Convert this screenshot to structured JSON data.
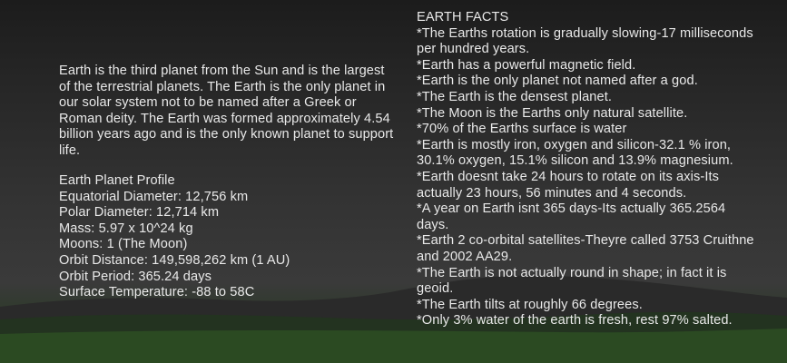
{
  "colors": {
    "text": "#e9e9e9",
    "sky_top": "#1c1c1c",
    "ground": "#243a20"
  },
  "intro": {
    "text": "Earth is the third planet from the Sun and is the largest of the terrestrial planets. The Earth is the only planet in our solar system not to be named after a Greek or Roman deity. The Earth was formed approximately 4.54 billion years ago and is the only known planet to support life."
  },
  "profile": {
    "title": "Earth Planet Profile",
    "lines": [
      "Equatorial Diameter:  12,756 km",
      "Polar Diameter: 12,714 km",
      "Mass: 5.97 x 10^24 kg",
      "Moons:  1 (The Moon)",
      "Orbit Distance: 149,598,262 km (1 AU)",
      "Orbit Period: 365.24 days",
      "Surface Temperature:  -88 to 58C"
    ]
  },
  "facts": {
    "title": "EARTH FACTS",
    "items": [
      "*The Earths rotation is gradually slowing-17 milliseconds per hundred years.",
      "*Earth has a powerful magnetic field.",
      "*Earth is the only planet not named after a god.",
      "*The Earth is the densest planet.",
      "*The Moon is the Earths only natural satellite.",
      "*70% of the Earths surface is water",
      "*Earth is mostly iron, oxygen and silicon-32.1 % iron, 30.1% oxygen, 15.1% silicon and 13.9% magnesium.",
      "*Earth doesnt take 24 hours to rotate on its axis-Its actually 23 hours, 56 minutes and 4 seconds.",
      "*A year on Earth isnt 365 days-Its actually 365.2564 days.",
      "*Earth 2 co-orbital satellites-Theyre called 3753 Cruithne and 2002 AA29.",
      "*The Earth is not actually round in shape; in fact it is geoid.",
      "*The Earth tilts at roughly 66 degrees.",
      "*Only 3% water of the earth is fresh, rest 97% salted."
    ]
  }
}
